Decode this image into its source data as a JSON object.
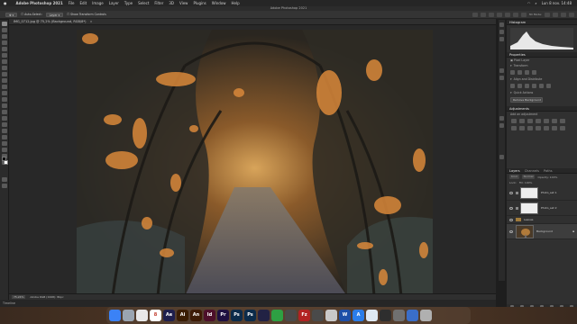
{
  "menubar": {
    "apple": "",
    "app_name": "Adobe Photoshop 2021",
    "items": [
      "File",
      "Edit",
      "Image",
      "Layer",
      "Type",
      "Select",
      "Filter",
      "3D",
      "View",
      "Plugins",
      "Window",
      "Help"
    ],
    "clock": "Lun 8 nov. 14:48"
  },
  "window_title": "Adobe Photoshop 2021",
  "options": {
    "auto_select_label": "Auto-Select:",
    "auto_select_value": "Layer",
    "show_transform": "Show Transform Controls",
    "mode_3d": "3D Mode:"
  },
  "document": {
    "tab_label": "IMG_0712.jpg @ 75,2% (Background, RGB/8*)",
    "close": "×"
  },
  "status": {
    "zoom": "75,24%",
    "info": "Adobe RGB (1998): 8bpc"
  },
  "timeline_label": "Timeline",
  "panels": {
    "histogram_tab": "Histogram",
    "properties_tab": "Properties",
    "pixel_layer": "Pixel Layer",
    "transform": "Transform",
    "align": "Align and Distribute",
    "quick_actions": "Quick Actions",
    "remove_bg": "Remove Background",
    "adjustments_tab": "Adjustments",
    "add_adjustment": "Add an adjustment",
    "layers_tab": "Layers",
    "channels_tab": "Channels",
    "paths_tab": "Paths",
    "kind": "Kind",
    "blend_mode": "Normal",
    "opacity": "Opacity: 100%",
    "lock": "Lock:",
    "fill": "Fill: 100%",
    "layers": [
      {
        "name": "Photo_set 1",
        "type": "adjustment"
      },
      {
        "name": "Photo_set 2",
        "type": "adjustment"
      },
      {
        "name": "Leaves",
        "type": "group"
      },
      {
        "name": "Background",
        "type": "image"
      }
    ]
  },
  "dock": {
    "apps": [
      {
        "name": "Finder",
        "label": "",
        "color": "#3b82f6"
      },
      {
        "name": "Launchpad",
        "label": "",
        "color": "#9aa5b1"
      },
      {
        "name": "Chrome",
        "label": "",
        "color": "#e8e8e8"
      },
      {
        "name": "Calendar",
        "label": "8",
        "color": "#ffffff"
      },
      {
        "name": "After Effects",
        "label": "Ae",
        "color": "#1f1f4d"
      },
      {
        "name": "Illustrator",
        "label": "Ai",
        "color": "#3a1d04"
      },
      {
        "name": "Animate",
        "label": "An",
        "color": "#3d1a05"
      },
      {
        "name": "InDesign",
        "label": "Id",
        "color": "#4d0f2a"
      },
      {
        "name": "Premiere",
        "label": "Pr",
        "color": "#1e0f40"
      },
      {
        "name": "Photoshop Beta",
        "label": "Ps",
        "color": "#0b2b4a"
      },
      {
        "name": "Photoshop",
        "label": "Ps",
        "color": "#0b2b4a"
      },
      {
        "name": "Lightroom",
        "label": "",
        "color": "#222244"
      },
      {
        "name": "FaceTime",
        "label": "",
        "color": "#2ea043"
      },
      {
        "name": "Keka",
        "label": "",
        "color": "#4a4a4a"
      },
      {
        "name": "FileZilla",
        "label": "Fz",
        "color": "#b22222"
      },
      {
        "name": "Messages",
        "label": "",
        "color": "#4a4a4a"
      },
      {
        "name": "Preview",
        "label": "",
        "color": "#c9c9c9"
      },
      {
        "name": "Word",
        "label": "W",
        "color": "#1d4fa8"
      },
      {
        "name": "App Store",
        "label": "A",
        "color": "#2b7de9"
      },
      {
        "name": "Safari",
        "label": "",
        "color": "#dfe9f3"
      },
      {
        "name": "Finder 2",
        "label": "",
        "color": "#2e2e2e"
      },
      {
        "name": "Settings",
        "label": "",
        "color": "#707070"
      },
      {
        "name": "Files",
        "label": "",
        "color": "#3a6ec9"
      },
      {
        "name": "Trash",
        "label": "",
        "color": "#b0b0b0"
      }
    ]
  }
}
